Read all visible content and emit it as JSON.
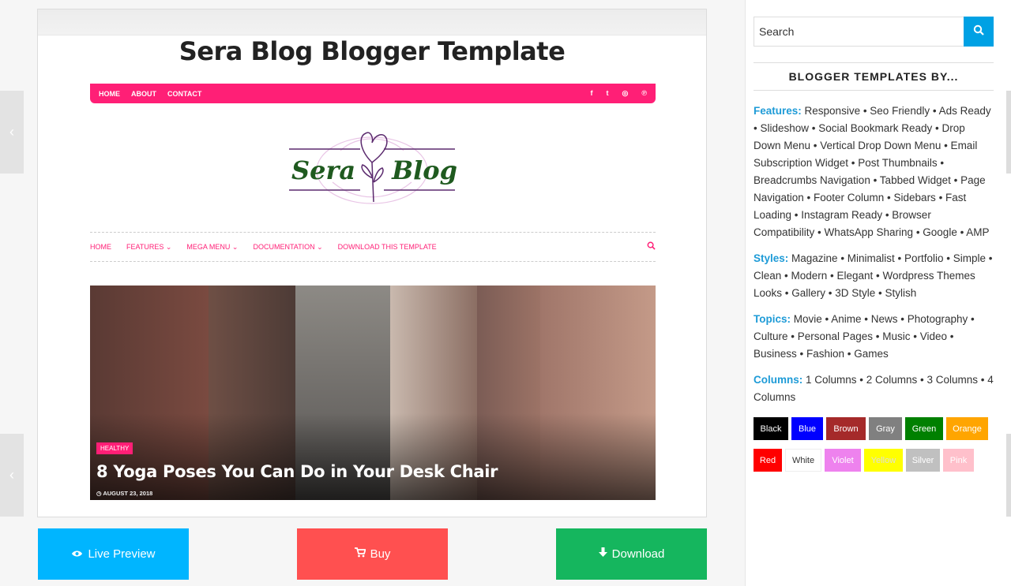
{
  "template": {
    "title": "Sera Blog Blogger Template",
    "preview": {
      "top_nav": [
        "HOME",
        "ABOUT",
        "CONTACT"
      ],
      "social_icons": [
        "facebook-icon",
        "twitter-icon",
        "instagram-icon",
        "pinterest-icon"
      ],
      "social_glyphs": [
        "f",
        "t",
        "◎",
        "℗"
      ],
      "logo_left": "Sera",
      "logo_right": "Blog",
      "menu": [
        "HOME",
        "FEATURES ⌄",
        "MEGA MENU ⌄",
        "DOCUMENTATION ⌄",
        "DOWNLOAD THIS TEMPLATE"
      ],
      "hero_badge": "HEALTHY",
      "hero_title": "8 Yoga Poses You Can Do in Your Desk Chair",
      "hero_date": "◷ AUGUST 23, 2018"
    }
  },
  "buttons": {
    "live_preview": "Live Preview",
    "buy": "Buy",
    "download": "Download"
  },
  "sidebar": {
    "search_placeholder": "Search",
    "heading": "BLOGGER TEMPLATES BY...",
    "features_label": "Features:",
    "features_text": " Responsive • Seo Friendly • Ads Ready • Slideshow • Social Bookmark Ready • Drop Down Menu • Vertical Drop Down Menu • Email Subscription Widget • Post Thumbnails • Breadcrumbs Navigation • Tabbed Widget • Page Navigation • Footer Column • Sidebars • Fast Loading • Instagram Ready • Browser Compatibility • WhatsApp Sharing • Google • AMP",
    "styles_label": "Styles:",
    "styles_text": " Magazine • Minimalist • Portfolio • Simple • Clean • Modern • Elegant • Wordpress Themes Looks • Gallery • 3D Style • Stylish",
    "topics_label": "Topics:",
    "topics_text": " Movie • Anime • News • Photography • Culture • Personal Pages • Music • Video • Business • Fashion • Games",
    "columns_label": "Columns:",
    "columns_text": " 1 Columns • 2 Columns • 3 Columns • 4 Columns",
    "colors_row1": [
      {
        "label": "Black",
        "color": "#000000",
        "text": "#ffffff"
      },
      {
        "label": "Blue",
        "color": "#0000ff",
        "text": "#ffffff"
      },
      {
        "label": "Brown",
        "color": "#a52a2a",
        "text": "#ffffff"
      },
      {
        "label": "Gray",
        "color": "#808080",
        "text": "#ffffff"
      },
      {
        "label": "Green",
        "color": "#008000",
        "text": "#ffffff"
      },
      {
        "label": "Orange",
        "color": "#ffa500",
        "text": "#ffffff"
      }
    ],
    "colors_row2": [
      {
        "label": "Red",
        "color": "#ff0000",
        "text": "#ffffff"
      },
      {
        "label": "White",
        "color": "#ffffff",
        "text": "#333333"
      },
      {
        "label": "Violet",
        "color": "#ee82ee",
        "text": "#ffffff"
      },
      {
        "label": "Yellow",
        "color": "#ffff00",
        "text": "#dddddd"
      },
      {
        "label": "Silver",
        "color": "#c0c0c0",
        "text": "#ffffff"
      },
      {
        "label": "Pink",
        "color": "#ffc0cb",
        "text": "#ffffff"
      }
    ]
  },
  "edge_arrow": "‹"
}
